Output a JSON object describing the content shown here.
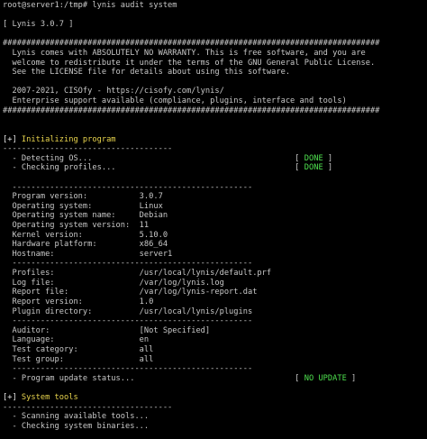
{
  "colors": {
    "background": "#000000",
    "text": "#c8c8c8",
    "status_ok": "#4ee04e",
    "section": "#e8d44d"
  },
  "prompt": "root@server1:/tmp# lynis audit system",
  "banner": {
    "version": "[ Lynis 3.0.7 ]",
    "hash_line": "################################################################################",
    "notice_1": "  Lynis comes with ABSOLUTELY NO WARRANTY. This is free software, and you are",
    "notice_2": "  welcome to redistribute it under the terms of the GNU General Public License.",
    "notice_3": "  See the LICENSE file for details about using this software.",
    "copyright": "  2007-2021, CISOfy - https://cisofy.com/lynis/",
    "support": "  Enterprise support available (compliance, plugins, interface and tools)"
  },
  "section_init": {
    "marker": "[+]",
    "title": " Initializing program",
    "rule": "------------------------------------"
  },
  "checks_init": [
    {
      "label": "  - Detecting OS...                                           [ ",
      "status": "DONE",
      "close": " ]"
    },
    {
      "label": "  - Checking profiles...                                      [ ",
      "status": "DONE",
      "close": " ]"
    }
  ],
  "info_rule": "  ---------------------------------------------------",
  "system_info": [
    "  Program version:           3.0.7",
    "  Operating system:          Linux",
    "  Operating system name:     Debian",
    "  Operating system version:  11",
    "  Kernel version:            5.10.0",
    "  Hardware platform:         x86_64",
    "  Hostname:                  server1"
  ],
  "paths_info": [
    "  Profiles:                  /usr/local/lynis/default.prf",
    "  Log file:                  /var/log/lynis.log",
    "  Report file:               /var/log/lynis-report.dat",
    "  Report version:            1.0",
    "  Plugin directory:          /usr/local/lynis/plugins"
  ],
  "audit_info": [
    "  Auditor:                   [Not Specified]",
    "  Language:                  en",
    "  Test category:             all",
    "  Test group:                all"
  ],
  "update_check": {
    "label": "  - Program update status...                                  [ ",
    "status": "NO UPDATE",
    "close": " ]"
  },
  "section_tools": {
    "marker": "[+]",
    "title": " System tools",
    "rule": "------------------------------------"
  },
  "checks_tools": [
    "  - Scanning available tools...",
    "  - Checking system binaries..."
  ]
}
